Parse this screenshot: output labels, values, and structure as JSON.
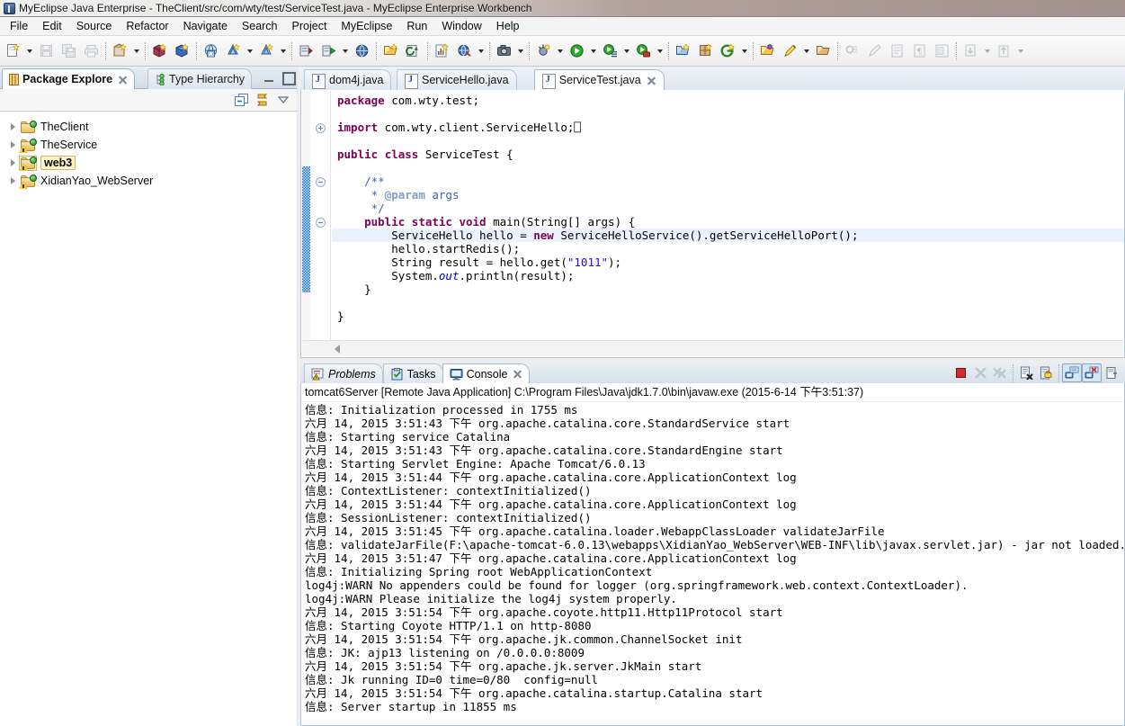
{
  "window": {
    "title": "MyEclipse Java Enterprise - TheClient/src/com/wty/test/ServiceTest.java - MyEclipse Enterprise Workbench",
    "icon": "myeclipse-icon"
  },
  "menubar": {
    "items": [
      {
        "label": "File"
      },
      {
        "label": "Edit"
      },
      {
        "label": "Source"
      },
      {
        "label": "Refactor"
      },
      {
        "label": "Navigate"
      },
      {
        "label": "Search"
      },
      {
        "label": "Project"
      },
      {
        "label": "MyEclipse"
      },
      {
        "label": "Run"
      },
      {
        "label": "Window"
      },
      {
        "label": "Help"
      }
    ]
  },
  "left_panel": {
    "tabs": [
      {
        "label": "Package Explore",
        "icon": "package-explorer-icon",
        "active": true,
        "closable": true
      },
      {
        "label": "Type Hierarchy",
        "icon": "type-hierarchy-icon",
        "active": false,
        "closable": false
      }
    ],
    "view_toolbar": [
      {
        "name": "collapse-all-icon"
      },
      {
        "name": "link-with-editor-icon"
      },
      {
        "name": "view-menu-icon"
      }
    ],
    "tree": [
      {
        "label": "TheClient",
        "icon": "java-project-icon",
        "warning": false,
        "selected": false
      },
      {
        "label": "TheService",
        "icon": "java-project-icon",
        "warning": true,
        "selected": false
      },
      {
        "label": "web3",
        "icon": "java-project-icon",
        "warning": true,
        "selected": true
      },
      {
        "label": "XidianYao_WebServer",
        "icon": "java-project-icon",
        "warning": true,
        "selected": false
      }
    ]
  },
  "editor": {
    "tabs": [
      {
        "label": "dom4j.java",
        "active": false,
        "closable": false
      },
      {
        "label": "ServiceHello.java",
        "active": false,
        "closable": false
      },
      {
        "label": "ServiceTest.java",
        "active": true,
        "closable": true
      }
    ],
    "code_lines": [
      {
        "indent": 0,
        "highlight": false,
        "fold": null,
        "tokens": [
          {
            "t": "package",
            "c": "kw"
          },
          {
            "t": " com.wty.test;",
            "c": ""
          }
        ]
      },
      {
        "indent": 0,
        "highlight": false,
        "fold": null,
        "tokens": []
      },
      {
        "indent": 0,
        "highlight": false,
        "fold": "plus",
        "tokens": [
          {
            "t": "import",
            "c": "kw"
          },
          {
            "t": " com.wty.client.ServiceHello;⎕",
            "c": ""
          }
        ]
      },
      {
        "indent": 0,
        "highlight": false,
        "fold": null,
        "tokens": []
      },
      {
        "indent": 0,
        "highlight": false,
        "fold": null,
        "tokens": [
          {
            "t": "public",
            "c": "kw"
          },
          {
            "t": " ",
            "c": ""
          },
          {
            "t": "class",
            "c": "kw"
          },
          {
            "t": " ServiceTest {",
            "c": ""
          }
        ]
      },
      {
        "indent": 0,
        "highlight": false,
        "fold": null,
        "tokens": []
      },
      {
        "indent": 1,
        "highlight": false,
        "fold": "minus",
        "tokens": [
          {
            "t": "/**",
            "c": "doc"
          }
        ]
      },
      {
        "indent": 1,
        "highlight": false,
        "fold": null,
        "tokens": [
          {
            "t": " * ",
            "c": "doc"
          },
          {
            "t": "@param",
            "c": "doct"
          },
          {
            "t": " args",
            "c": "doc"
          }
        ]
      },
      {
        "indent": 1,
        "highlight": false,
        "fold": null,
        "tokens": [
          {
            "t": " */",
            "c": "doc"
          }
        ]
      },
      {
        "indent": 1,
        "highlight": false,
        "fold": "minus",
        "tokens": [
          {
            "t": "public",
            "c": "kw"
          },
          {
            "t": " ",
            "c": ""
          },
          {
            "t": "static",
            "c": "kw"
          },
          {
            "t": " ",
            "c": ""
          },
          {
            "t": "void",
            "c": "kw"
          },
          {
            "t": " main(String[] args) {",
            "c": ""
          }
        ]
      },
      {
        "indent": 2,
        "highlight": true,
        "fold": null,
        "tokens": [
          {
            "t": "ServiceHello hello = ",
            "c": ""
          },
          {
            "t": "new",
            "c": "kw"
          },
          {
            "t": " ServiceHelloService().getServiceHelloPort();",
            "c": ""
          }
        ]
      },
      {
        "indent": 2,
        "highlight": false,
        "fold": null,
        "tokens": [
          {
            "t": "hello.startRedis();",
            "c": ""
          }
        ]
      },
      {
        "indent": 2,
        "highlight": false,
        "fold": null,
        "tokens": [
          {
            "t": "String result = hello.get(",
            "c": ""
          },
          {
            "t": "\"1011\"",
            "c": "str"
          },
          {
            "t": ");",
            "c": ""
          }
        ]
      },
      {
        "indent": 2,
        "highlight": false,
        "fold": null,
        "tokens": [
          {
            "t": "System.",
            "c": ""
          },
          {
            "t": "out",
            "c": "fld"
          },
          {
            "t": ".println(result);",
            "c": ""
          }
        ]
      },
      {
        "indent": 1,
        "highlight": false,
        "fold": null,
        "tokens": [
          {
            "t": "}",
            "c": ""
          }
        ]
      },
      {
        "indent": 0,
        "highlight": false,
        "fold": null,
        "tokens": []
      },
      {
        "indent": 0,
        "highlight": false,
        "fold": null,
        "tokens": [
          {
            "t": "}",
            "c": ""
          }
        ]
      }
    ]
  },
  "console_panel": {
    "tabs": [
      {
        "label": "Problems",
        "icon": "problems-icon",
        "active": false,
        "italic": true,
        "closable": false
      },
      {
        "label": "Tasks",
        "icon": "tasks-icon",
        "active": false,
        "italic": false,
        "closable": false
      },
      {
        "label": "Console",
        "icon": "console-icon",
        "active": true,
        "italic": false,
        "closable": true
      }
    ],
    "toolbar": [
      {
        "name": "terminate-icon",
        "state": "enabled"
      },
      {
        "name": "remove-launch-icon",
        "state": "disabled"
      },
      {
        "name": "remove-all-terminated-icon",
        "state": "disabled"
      },
      {
        "name": "clear-console-icon",
        "state": "enabled"
      },
      {
        "name": "scroll-lock-icon",
        "state": "enabled"
      },
      {
        "name": "show-console-on-output-icon",
        "state": "pressed"
      },
      {
        "name": "show-console-on-error-icon",
        "state": "pressed"
      },
      {
        "name": "pin-console-icon",
        "state": "enabled"
      }
    ],
    "process_label": "tomcat6Server [Remote Java Application] C:\\Program Files\\Java\\jdk1.7.0\\bin\\javaw.exe (2015-6-14 下午3:51:37)",
    "log_lines": [
      "信息: Initialization processed in 1755 ms",
      "六月 14, 2015 3:51:43 下午 org.apache.catalina.core.StandardService start",
      "信息: Starting service Catalina",
      "六月 14, 2015 3:51:43 下午 org.apache.catalina.core.StandardEngine start",
      "信息: Starting Servlet Engine: Apache Tomcat/6.0.13",
      "六月 14, 2015 3:51:44 下午 org.apache.catalina.core.ApplicationContext log",
      "信息: ContextListener: contextInitialized()",
      "六月 14, 2015 3:51:44 下午 org.apache.catalina.core.ApplicationContext log",
      "信息: SessionListener: contextInitialized()",
      "六月 14, 2015 3:51:45 下午 org.apache.catalina.loader.WebappClassLoader validateJarFile",
      "信息: validateJarFile(F:\\apache-tomcat-6.0.13\\webapps\\XidianYao_WebServer\\WEB-INF\\lib\\javax.servlet.jar) - jar not loaded. See Servl",
      "六月 14, 2015 3:51:47 下午 org.apache.catalina.core.ApplicationContext log",
      "信息: Initializing Spring root WebApplicationContext",
      "log4j:WARN No appenders could be found for logger (org.springframework.web.context.ContextLoader).",
      "log4j:WARN Please initialize the log4j system properly.",
      "六月 14, 2015 3:51:54 下午 org.apache.coyote.http11.Http11Protocol start",
      "信息: Starting Coyote HTTP/1.1 on http-8080",
      "六月 14, 2015 3:51:54 下午 org.apache.jk.common.ChannelSocket init",
      "信息: JK: ajp13 listening on /0.0.0.0:8009",
      "六月 14, 2015 3:51:54 下午 org.apache.jk.server.JkMain start",
      "信息: Jk running ID=0 time=0/80  config=null",
      "六月 14, 2015 3:51:54 下午 org.apache.catalina.startup.Catalina start",
      "信息: Server startup in 11855 ms"
    ]
  },
  "toolbar": {
    "groups": [
      {
        "buttons": [
          {
            "name": "new-wizard-icon",
            "arrow": true,
            "state": "enabled"
          },
          {
            "name": "save-icon",
            "arrow": false,
            "state": "disabled"
          },
          {
            "name": "save-all-icon",
            "arrow": false,
            "state": "disabled"
          },
          {
            "name": "print-icon",
            "arrow": false,
            "state": "disabled"
          }
        ]
      },
      {
        "buttons": [
          {
            "name": "new-java-package-icon",
            "arrow": true,
            "state": "enabled"
          }
        ]
      },
      {
        "buttons": [
          {
            "name": "open-type-icon",
            "arrow": false,
            "state": "enabled"
          },
          {
            "name": "new-class-icon",
            "arrow": false,
            "state": "enabled"
          }
        ]
      },
      {
        "buttons": [
          {
            "name": "web-20-icon",
            "arrow": false,
            "state": "enabled"
          },
          {
            "name": "deploy-icon",
            "arrow": true,
            "state": "enabled"
          },
          {
            "name": "undeploy-icon",
            "arrow": true,
            "state": "enabled"
          }
        ]
      },
      {
        "buttons": [
          {
            "name": "new-server-icon",
            "arrow": false,
            "state": "enabled"
          },
          {
            "name": "run-server-icon",
            "arrow": true,
            "state": "enabled"
          },
          {
            "name": "open-browser-icon",
            "arrow": false,
            "state": "enabled"
          }
        ]
      },
      {
        "buttons": [
          {
            "name": "open-perspective-icon",
            "arrow": false,
            "state": "enabled"
          },
          {
            "name": "refresh-icon",
            "arrow": false,
            "state": "enabled"
          }
        ]
      },
      {
        "buttons": [
          {
            "name": "new-report-icon",
            "arrow": false,
            "state": "enabled"
          },
          {
            "name": "web-preview-icon",
            "arrow": true,
            "state": "enabled"
          }
        ]
      },
      {
        "buttons": [
          {
            "name": "snapshot-icon",
            "arrow": true,
            "state": "enabled"
          }
        ]
      },
      {
        "buttons": [
          {
            "name": "debug-icon",
            "arrow": true,
            "state": "enabled"
          },
          {
            "name": "run-icon",
            "arrow": true,
            "state": "enabled"
          },
          {
            "name": "run-history-icon",
            "arrow": true,
            "state": "enabled"
          },
          {
            "name": "external-tools-icon",
            "arrow": true,
            "state": "enabled"
          }
        ]
      },
      {
        "buttons": [
          {
            "name": "new-xml-icon",
            "arrow": false,
            "state": "enabled"
          },
          {
            "name": "new-hibernate-icon",
            "arrow": false,
            "state": "enabled"
          },
          {
            "name": "generate-icon",
            "arrow": true,
            "state": "enabled"
          }
        ]
      },
      {
        "buttons": [
          {
            "name": "open-resource-icon",
            "arrow": false,
            "state": "enabled"
          },
          {
            "name": "edit-icon",
            "arrow": true,
            "state": "enabled"
          },
          {
            "name": "package-icon",
            "arrow": false,
            "state": "enabled"
          }
        ]
      },
      {
        "buttons": [
          {
            "name": "toggle-mark-occurrences-icon",
            "arrow": false,
            "state": "disabled"
          },
          {
            "name": "pencil-icon",
            "arrow": false,
            "state": "disabled"
          },
          {
            "name": "show-whitespace-icon",
            "arrow": false,
            "state": "disabled"
          },
          {
            "name": "show-paragraph-icon",
            "arrow": false,
            "state": "disabled"
          },
          {
            "name": "block-selection-icon",
            "arrow": false,
            "state": "disabled"
          }
        ]
      },
      {
        "buttons": [
          {
            "name": "next-annotation-icon",
            "arrow": true,
            "state": "disabled"
          },
          {
            "name": "previous-annotation-icon",
            "arrow": true,
            "state": "disabled"
          }
        ]
      }
    ]
  },
  "colors": {
    "title_accent": "#a2918c",
    "tab_active": "#ffffff",
    "selection": "#fff2c7",
    "keyword": "#7f0055",
    "string": "#2a00ff",
    "javadoc": "#3f5fbf",
    "current_line": "#eaf2fd",
    "change_bar": "#1b74d6"
  }
}
